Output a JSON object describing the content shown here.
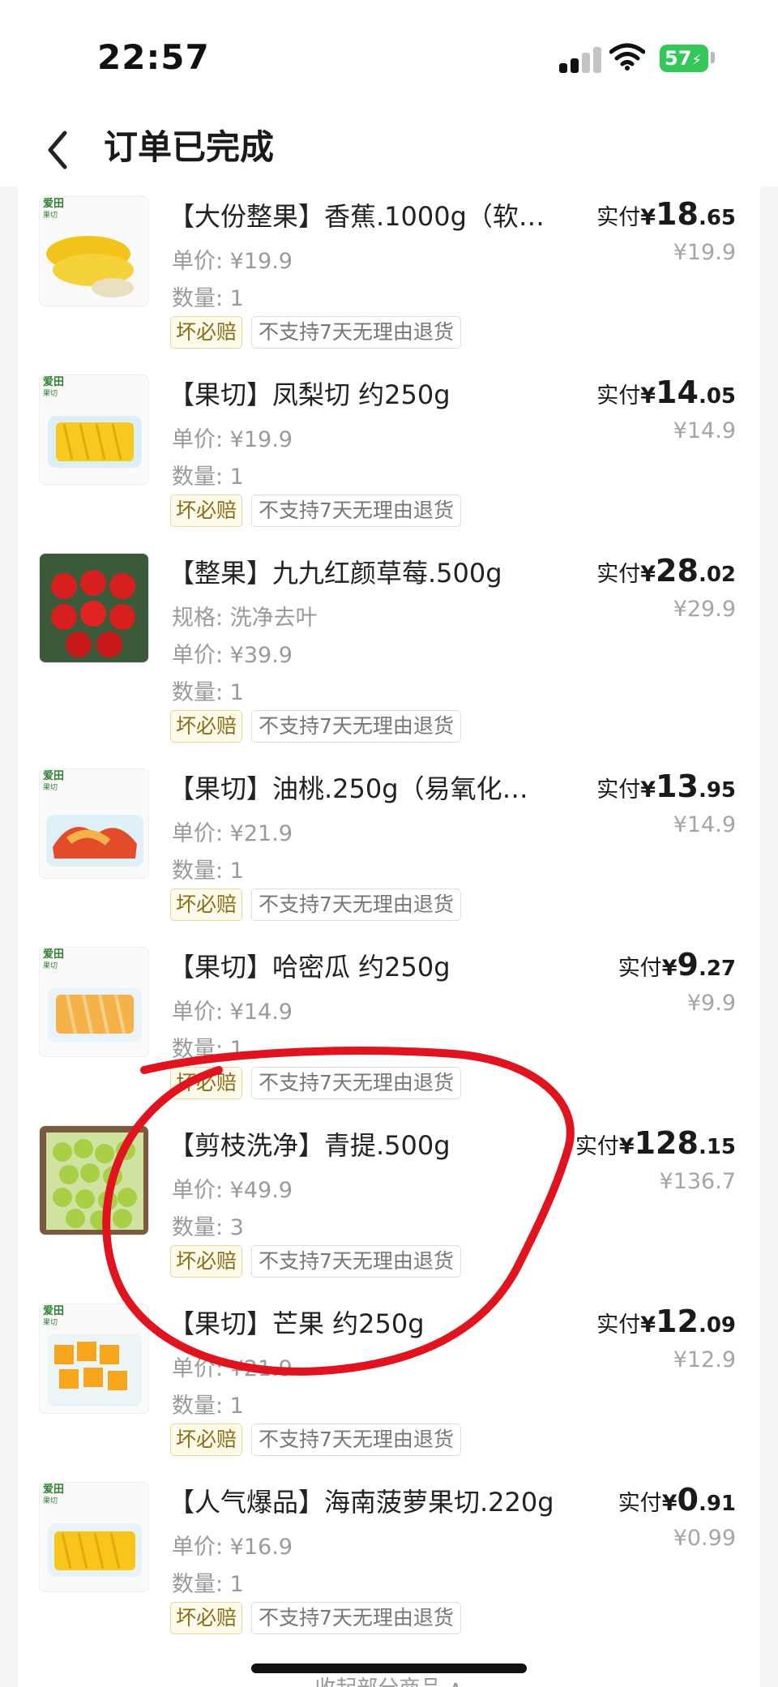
{
  "status_bar": {
    "time": "22:57",
    "battery": "57"
  },
  "nav": {
    "title": "订单已完成"
  },
  "labels": {
    "paid": "实付",
    "currency": "¥",
    "tag_bad": "坏必赔",
    "tag_policy": "不支持7天无理由退货"
  },
  "items": [
    {
      "title": "【大份整果】香蕉.1000g（软…",
      "spec": null,
      "unit_price": "单价: ¥19.9",
      "qty": "数量: 1",
      "paid_int": "18",
      "paid_dec": ".65",
      "orig": "¥19.9",
      "thumb": "banana"
    },
    {
      "title": "【果切】凤梨切 约250g",
      "spec": null,
      "unit_price": "单价: ¥19.9",
      "qty": "数量: 1",
      "paid_int": "14",
      "paid_dec": ".05",
      "orig": "¥14.9",
      "thumb": "pineapple"
    },
    {
      "title": "【整果】九九红颜草莓.500g",
      "spec": "规格: 洗净去叶",
      "unit_price": "单价: ¥39.9",
      "qty": "数量: 1",
      "paid_int": "28",
      "paid_dec": ".02",
      "orig": "¥29.9",
      "thumb": "strawberry"
    },
    {
      "title": "【果切】油桃.250g（易氧化…",
      "spec": null,
      "unit_price": "单价: ¥21.9",
      "qty": "数量: 1",
      "paid_int": "13",
      "paid_dec": ".95",
      "orig": "¥14.9",
      "thumb": "nectarine"
    },
    {
      "title": "【果切】哈密瓜 约250g",
      "spec": null,
      "unit_price": "单价: ¥14.9",
      "qty": "数量: 1",
      "paid_int": "9",
      "paid_dec": ".27",
      "orig": "¥9.9",
      "thumb": "melon"
    },
    {
      "title": "【剪枝洗净】青提.500g",
      "spec": null,
      "unit_price": "单价: ¥49.9",
      "qty": "数量: 3",
      "paid_int": "128",
      "paid_dec": ".15",
      "orig": "¥136.7",
      "thumb": "grape"
    },
    {
      "title": "【果切】芒果 约250g",
      "spec": null,
      "unit_price": "单价: ¥21.9",
      "qty": "数量: 1",
      "paid_int": "12",
      "paid_dec": ".09",
      "orig": "¥12.9",
      "thumb": "mango"
    },
    {
      "title": "【人气爆品】海南菠萝果切.220g",
      "spec": null,
      "unit_price": "单价: ¥16.9",
      "qty": "数量: 1",
      "paid_int": "0",
      "paid_dec": ".91",
      "orig": "¥0.99",
      "thumb": "pineapple2"
    }
  ],
  "brand": {
    "main": "爱田",
    "sub": "果切"
  },
  "footer": {
    "collapse": "收起部分商品 ∧"
  },
  "colors": {
    "annotation_circle": "#e0141e",
    "tag_bad_text": "#8a6d1a",
    "battery": "#34c759"
  }
}
